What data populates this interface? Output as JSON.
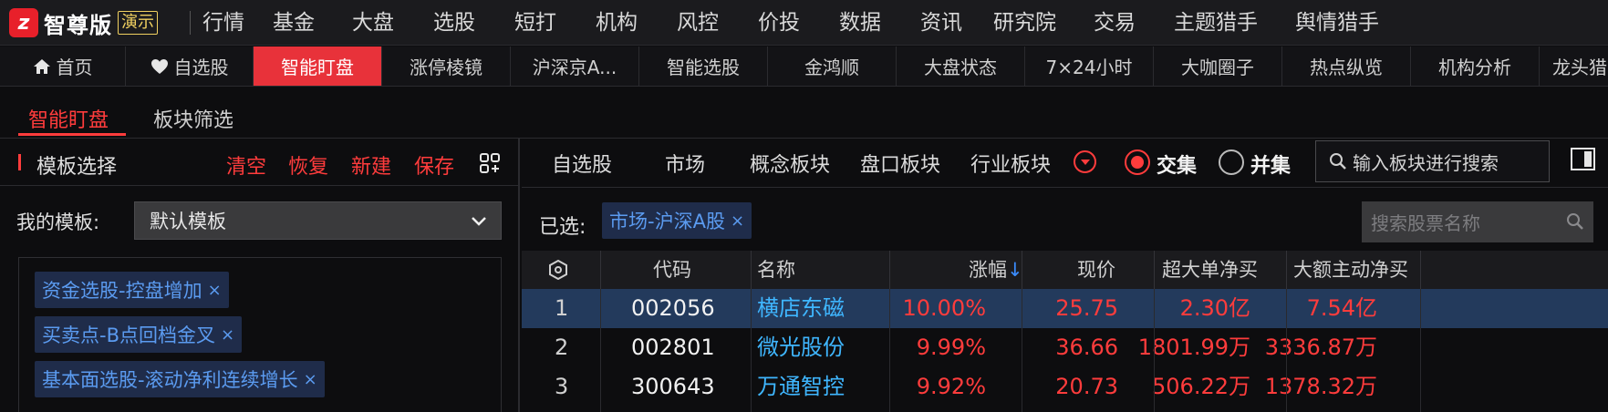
{
  "app": {
    "logo_mark": "z",
    "logo_text": "智尊版",
    "logo_badge": "演示"
  },
  "menu": [
    "行情",
    "基金",
    "大盘",
    "选股",
    "短打",
    "机构",
    "风控",
    "价投",
    "数据",
    "资讯",
    "研究院",
    "交易",
    "主题猎手",
    "舆情猎手"
  ],
  "tabs": [
    "首页",
    "自选股",
    "智能盯盘",
    "涨停棱镜",
    "沪深京A...",
    "智能选股",
    "金鸿顺",
    "大盘状态",
    "7×24小时",
    "大咖圈子",
    "热点纵览",
    "机构分析",
    "龙头猎"
  ],
  "active_tab": "智能盯盘",
  "subtabs": [
    "智能盯盘",
    "板块筛选"
  ],
  "left_panel": {
    "title": "模板选择",
    "actions": [
      "清空",
      "恢复",
      "新建",
      "保存"
    ],
    "my_template_label": "我的模板:",
    "template_value": "默认模板",
    "tags": [
      "资金选股-控盘增加",
      "买卖点-B点回档金叉",
      "基本面选股-滚动净利连续增长"
    ]
  },
  "filter": {
    "items": [
      "自选股",
      "市场",
      "概念板块",
      "盘口板块",
      "行业板块"
    ],
    "radio_intersect": "交集",
    "radio_union": "并集",
    "search_placeholder": "输入板块进行搜索"
  },
  "selected": {
    "label": "已选:",
    "tag": "市场-沪深A股"
  },
  "stock_search_placeholder": "搜索股票名称",
  "table": {
    "headers": {
      "code": "代码",
      "name": "名称",
      "change": "涨幅",
      "sort_indicator": "↓",
      "price": "现价",
      "super_large_net": "超大单净买",
      "large_active_net": "大额主动净买"
    },
    "rows": [
      {
        "idx": "1",
        "code": "002056",
        "name": "横店东磁",
        "change": "10.00%",
        "price": "25.75",
        "super": "2.30亿",
        "large": "7.54亿"
      },
      {
        "idx": "2",
        "code": "002801",
        "name": "微光股份",
        "change": "9.99%",
        "price": "36.66",
        "super": "1801.99万",
        "large": "3336.87万"
      },
      {
        "idx": "3",
        "code": "300643",
        "name": "万通智控",
        "change": "9.92%",
        "price": "20.73",
        "super": "506.22万",
        "large": "1378.32万"
      }
    ]
  },
  "colors": {
    "accent_red": "#ff3c3c",
    "active_tab_bg": "#e8323a",
    "tag_text_blue": "#5b9bf0",
    "name_cyan": "#3fb6ff",
    "selected_row_bg": "#233a5c"
  }
}
